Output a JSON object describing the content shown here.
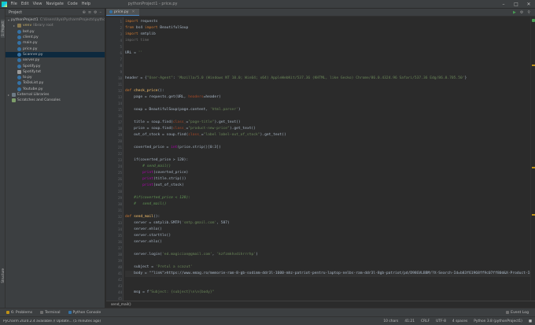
{
  "menubar": {
    "items": [
      "File",
      "Edit",
      "View",
      "Navigate",
      "Code",
      "Help"
    ],
    "title": "pythonProject1 - price.py"
  },
  "left_strip": {
    "project_label": "1: Project",
    "structure_label": "Structure"
  },
  "project_panel": {
    "header": "Project",
    "tree": [
      {
        "label": "pythonProject1",
        "path": "C:\\Users\\Ilya\\PycharmProjects\\pythonProject1",
        "indent": 0,
        "kind": "folder",
        "arrow": "▾"
      },
      {
        "label": "venv",
        "path": "library root",
        "indent": 1,
        "kind": "folder",
        "arrow": "▸",
        "selected": false,
        "yellow": true
      },
      {
        "label": "bot.py",
        "indent": 1,
        "kind": "py"
      },
      {
        "label": "client.py",
        "indent": 1,
        "kind": "py"
      },
      {
        "label": "main.py",
        "indent": 1,
        "kind": "py"
      },
      {
        "label": "price.py",
        "indent": 1,
        "kind": "py"
      },
      {
        "label": "Scanner.py",
        "indent": 1,
        "kind": "py",
        "selected": true
      },
      {
        "label": "server.py",
        "indent": 1,
        "kind": "py"
      },
      {
        "label": "Spotify.py",
        "indent": 1,
        "kind": "py"
      },
      {
        "label": "Spotify.txt",
        "indent": 1,
        "kind": "txt"
      },
      {
        "label": "to.py",
        "indent": 1,
        "kind": "py"
      },
      {
        "label": "ToDoList.py",
        "indent": 1,
        "kind": "py"
      },
      {
        "label": "Youtube.py",
        "indent": 1,
        "kind": "py"
      },
      {
        "label": "External Libraries",
        "indent": 0,
        "kind": "lib",
        "arrow": "▸"
      },
      {
        "label": "Scratches and Consoles",
        "indent": 0,
        "kind": "scr",
        "arrow": ""
      }
    ]
  },
  "editor": {
    "tab": "price.py",
    "line_numbers": [
      "1",
      "2",
      "3",
      "4",
      "5",
      "6",
      "7",
      "8",
      "9",
      "10",
      "11",
      "12",
      "13",
      "14",
      "15",
      "16",
      "17",
      "18",
      "19",
      "20",
      "21",
      "22",
      "23",
      "24",
      "25",
      "26",
      "27",
      "28",
      "29",
      "30",
      "31",
      "32",
      "33",
      "34",
      "35",
      "36",
      "37",
      "38",
      "39",
      "40",
      "41",
      "42",
      "43",
      "44",
      "45"
    ],
    "breadcrumb": "send_mail()",
    "lines": [
      "import requests",
      "from bs4 import BeautifulSoup",
      "import smtplib",
      "import time",
      "",
      "URL = ''",
      "",
      "",
      "",
      "header = {\"User-Agent\": 'Mozilla/5.0 (Windows NT 10.0; Win64; x64) AppleWebKit/537.36 (KHTML, like Gecko) Chrome/86.0.4324.96 Safari/537.36 Edg/86.0.705.50'}",
      "",
      "def check_price():",
      "    page = requests.get(URL, headers=header)",
      "",
      "    soup = BeautifulSoup(page.content, 'html.parser')",
      "",
      "    title = soup.find(class_=\"page-title\").get_text()",
      "    price = soup.find(class_=\"product-new-price\").get_text()",
      "    out_of_stock = soup.find(class_=\"label label-out_of_stock\").get_text()",
      "",
      "    coverted_price = int(price.strip()[0:3])",
      "",
      "    if(coverted_price > 120):",
      "        # send_mail()",
      "        print(coverted_price)",
      "        print(title.strip())",
      "        print(out_of_stock)",
      "",
      "    #if(coverted_price < 120):",
      "    #   send_mail()",
      "",
      "def send_mail():",
      "    server = smtplib.SMTP('smtp.gmail.com', 587)",
      "    server.ehlo()",
      "    server.starttls()",
      "    server.ehlo()",
      "",
      "    server.login('ed.magician@gmail.com', 'kzfzmkhvdihrrrhp')",
      "",
      "    subject = 'Pretul a scazut'",
      "    body = \"https://www.emag.ro/memorie-ram-8-gb-sodimm-ddr3l-1600-mhz-patriot-pentru-laptop-nelbs-ram-ddr3l-8gb-patriot/pd/D98GVLBBM/?X-Search-Id=b83f61968ff9c07ff80d&X-Product-Id\"",
      "",
      "",
      "    msg = f\"Subject: {subject}\\n\\n{body}\"",
      ""
    ]
  },
  "toolwindows": {
    "items": [
      "6: Problems",
      "Terminal",
      "Python Console"
    ],
    "event_log": "Event Log"
  },
  "statusbar": {
    "message": "PyCharm 2020.2.4 available // Update... (5 minutes ago)",
    "chars": "10 chars",
    "position": "41:21",
    "line_sep": "CRLF",
    "encoding": "UTF-8",
    "indent": "4 spaces",
    "interpreter": "Python 3.8 (pythonProject1)"
  },
  "colors": {
    "accent": "#4a88c7",
    "selection": "#0d293e",
    "background": "#2b2b2b",
    "panel": "#3c3f41"
  }
}
